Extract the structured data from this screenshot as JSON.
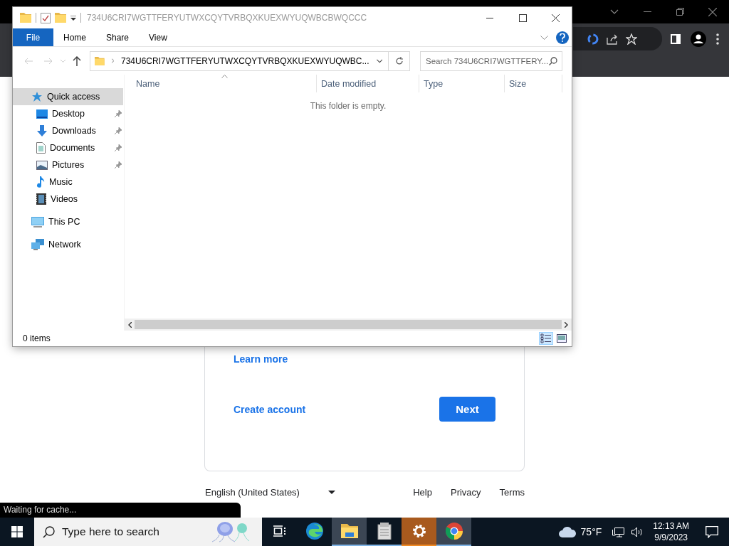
{
  "explorer": {
    "title": "734U6CRI7WGTTFERYUTWXCQYTVRBQXKUEXWYUQWBCBWQCCC",
    "file_tab": "File",
    "ribbon_tabs": [
      "Home",
      "Share",
      "View"
    ],
    "address": "734U6CRI7WGTTFERYUTWXCQYTVRBQXKUEXWYUQWBC...",
    "search": {
      "placeholder": "Search 734U6CRI7WGTTFERY..."
    },
    "columns": [
      "Name",
      "Date modified",
      "Type",
      "Size"
    ],
    "nav_items": [
      {
        "label": "Quick access",
        "kind": "star",
        "selected": true,
        "children": [
          {
            "label": "Desktop",
            "kind": "desktop",
            "pinned": true
          },
          {
            "label": "Downloads",
            "kind": "downloads",
            "pinned": true
          },
          {
            "label": "Documents",
            "kind": "documents",
            "pinned": true
          },
          {
            "label": "Pictures",
            "kind": "pictures",
            "pinned": true
          },
          {
            "label": "Music",
            "kind": "music",
            "pinned": false
          },
          {
            "label": "Videos",
            "kind": "videos",
            "pinned": false
          }
        ]
      },
      {
        "label": "This PC",
        "kind": "pc",
        "selected": false
      },
      {
        "label": "Network",
        "kind": "network",
        "selected": false
      }
    ],
    "empty_message": "This folder is empty.",
    "status": "0 items",
    "views": [
      {
        "kind": "details",
        "selected": true
      },
      {
        "kind": "large_icons",
        "selected": false
      }
    ]
  },
  "signin_page": {
    "learn_more": "Learn more",
    "create_account": "Create account",
    "next_button": "Next",
    "language": "English (United States)",
    "footer_links": [
      "Help",
      "Privacy",
      "Terms"
    ]
  },
  "status_bubble": "Waiting for cache...",
  "taskbar": {
    "search_placeholder": "Type here to search",
    "apps": [
      {
        "kind": "task_view",
        "active": false,
        "running": false
      },
      {
        "kind": "edge",
        "active": false,
        "running": false
      },
      {
        "kind": "explorer",
        "active": true,
        "running": true
      },
      {
        "kind": "notepad",
        "active": false,
        "running": true
      },
      {
        "kind": "settings",
        "active": false,
        "running": true
      },
      {
        "kind": "chrome",
        "active": true,
        "running": true
      }
    ],
    "weather": "75°F",
    "time": "12:13 AM",
    "date": "9/9/2023"
  }
}
